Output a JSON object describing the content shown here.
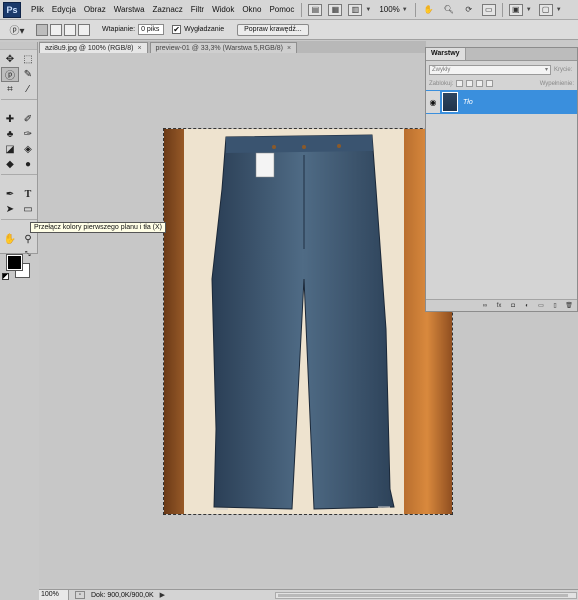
{
  "app": {
    "logo": "Ps",
    "menu": [
      "Plik",
      "Edycja",
      "Obraz",
      "Warstwa",
      "Zaznacz",
      "Filtr",
      "Widok",
      "Okno",
      "Pomoc"
    ],
    "zoom_display": "100%"
  },
  "options_bar": {
    "feather_label": "Wtapianie:",
    "feather_value": "0 piks",
    "antialias_label": "Wygładzanie",
    "antialias_checked": "✔",
    "refine_edge_button": "Popraw krawędź..."
  },
  "document_tabs": [
    {
      "label": "azi8u9.jpg @ 100% (RGB/8)",
      "close": "×",
      "active": true
    },
    {
      "label": "preview-01 @ 33,3% (Warstwa 5,RGB/8)",
      "close": "×",
      "active": false
    }
  ],
  "toolbox": {
    "tooltip": "Przełącz kolory pierwszego planu i tła (X)",
    "foreground_color": "#000000",
    "background_color": "#ffffff"
  },
  "layers_panel": {
    "tab": "Warstwy",
    "blend_mode": "Zwykły",
    "opacity_label": "Krycie:",
    "lock_label": "Zablokuj:",
    "fill_label": "Wypełnienie:",
    "layer_name": "Tło",
    "selection_color": "#3a8fdd"
  },
  "status_bar": {
    "zoom": "100%",
    "doc_size": "Dok: 900,0K/900,0K"
  }
}
